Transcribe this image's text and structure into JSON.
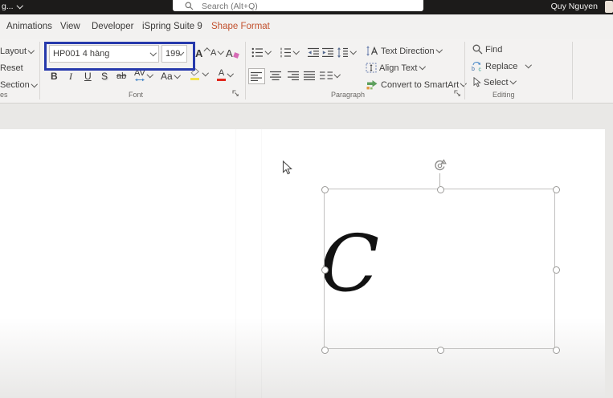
{
  "topbar": {
    "file_label": "g...",
    "search_placeholder": "Search (Alt+Q)",
    "user_name": "Quy Nguyen"
  },
  "menubar": {
    "active_tab": "Shape Format",
    "active_color": "#c2512e",
    "tabs": [
      {
        "label": "Animations"
      },
      {
        "label": "View"
      },
      {
        "label": "Developer"
      },
      {
        "label": "iSpring Suite 9"
      },
      {
        "label": "Shape Format"
      }
    ]
  },
  "ribbon": {
    "slides": {
      "layout": "Layout",
      "reset": "Reset",
      "section": "Section",
      "group_label": "es"
    },
    "font": {
      "name_value": "HP001 4 hàng",
      "size_value": "199",
      "highlight_border": "#2639ac",
      "grow": "A",
      "shrink": "A",
      "clear": "A",
      "bold": "B",
      "italic": "I",
      "underline": "U",
      "shadow": "S",
      "strikethrough": "ab",
      "char_spacing": "AV",
      "change_case": "Aa",
      "font_color": "A",
      "font_color_bar": "#e0281e",
      "highlight_bar": "#f3e34a",
      "group_label": "Font"
    },
    "paragraph": {
      "text_direction": "Text Direction",
      "align_text": "Align Text",
      "smartart": "Convert to SmartArt",
      "group_label": "Paragraph"
    },
    "editing": {
      "find": "Find",
      "replace": "Replace",
      "select": "Select",
      "group_label": "Editing"
    }
  },
  "slide": {
    "textbox_text": "C"
  }
}
